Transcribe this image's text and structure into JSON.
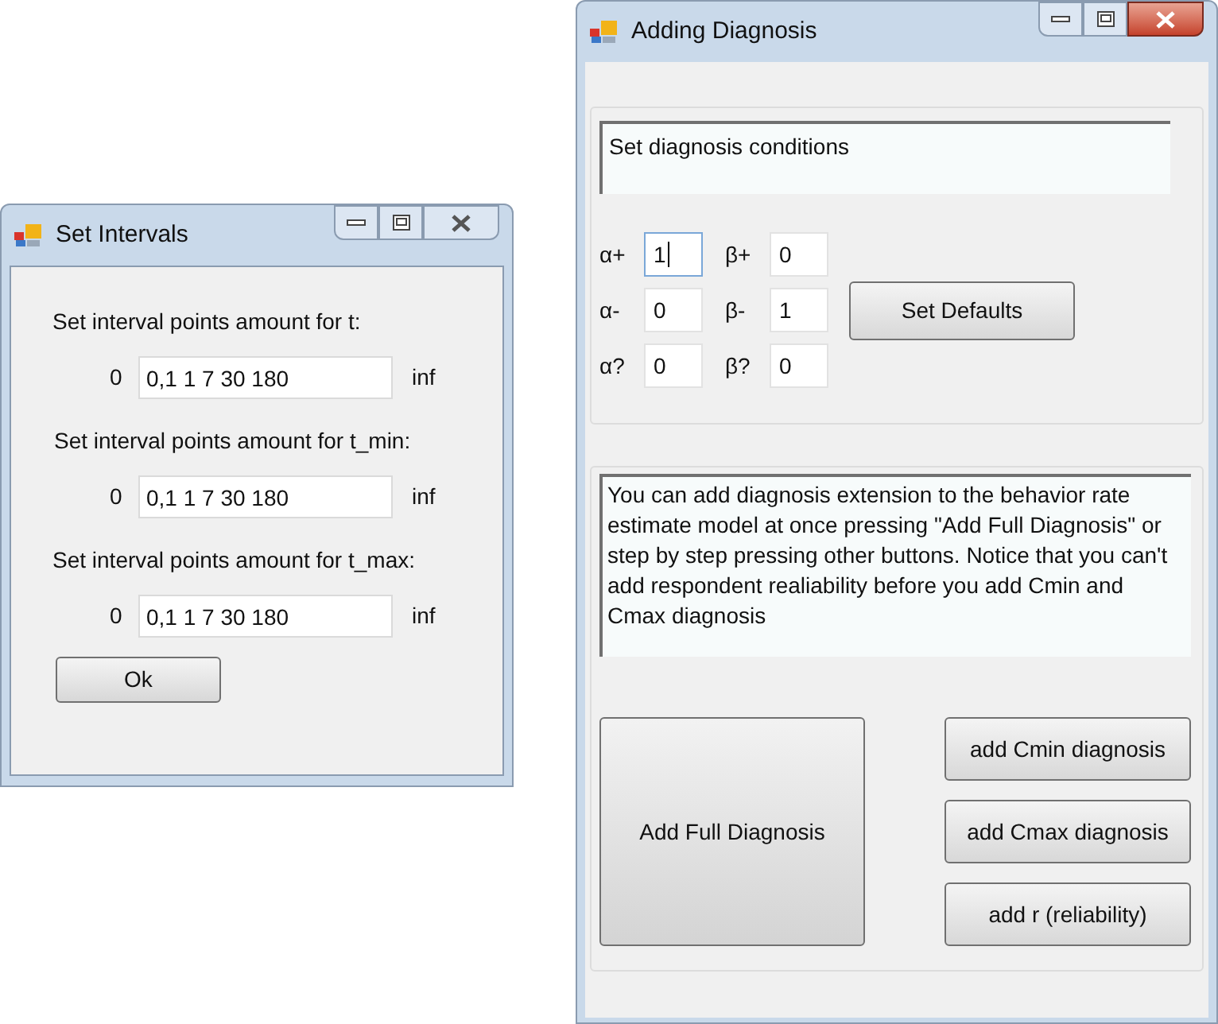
{
  "windows": [
    {
      "title": "Set Intervals",
      "active": false,
      "rows": [
        {
          "label": "Set interval points amount for t:",
          "start": "0",
          "value": "0,1 1 7 30 180",
          "end": "inf"
        },
        {
          "label": "Set interval points amount for t_min:",
          "start": "0",
          "value": "0,1 1 7 30 180",
          "end": "inf"
        },
        {
          "label": "Set interval points amount for t_max:",
          "start": "0",
          "value": "0,1 1 7 30 180",
          "end": "inf"
        }
      ],
      "ok_button": "Ok"
    },
    {
      "title": "Adding Diagnosis",
      "active": true,
      "conditions_text": "Set diagnosis conditions",
      "parameters": [
        [
          {
            "label": "α+",
            "value": "1",
            "focused": true
          },
          {
            "label": "β+",
            "value": "0",
            "focused": false
          }
        ],
        [
          {
            "label": "α-",
            "value": "0",
            "focused": false
          },
          {
            "label": "β-",
            "value": "1",
            "focused": false
          }
        ],
        [
          {
            "label": "α?",
            "value": "0",
            "focused": false
          },
          {
            "label": "β?",
            "value": "0",
            "focused": false
          }
        ]
      ],
      "defaults_button": "Set Defaults",
      "info_text": "You can add diagnosis extension to the behavior rate estimate model at once pressing \"Add Full Diagnosis\" or step by step pressing other buttons. Notice that you can't add respondent realiability before you add Cmin and Cmax diagnosis",
      "full_button": "Add Full Diagnosis",
      "step_buttons": [
        "add Cmin diagnosis",
        "add Cmax diagnosis",
        "add r (reliability)"
      ]
    }
  ]
}
